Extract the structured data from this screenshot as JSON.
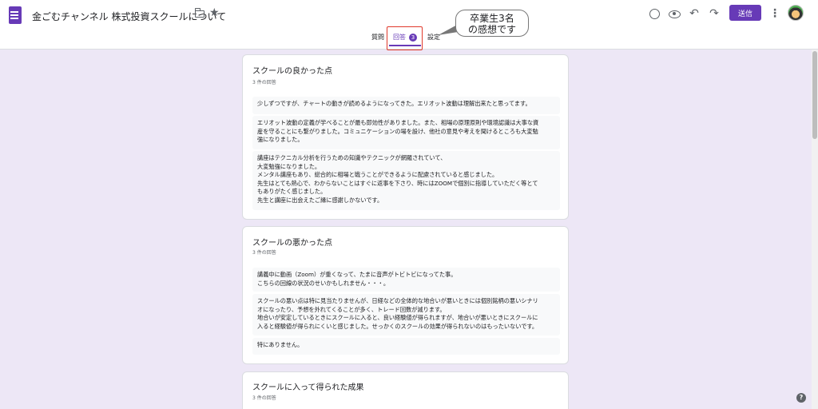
{
  "header": {
    "title": "金ごむチャンネル 株式投資スクールについて",
    "send_label": "送信",
    "icons": [
      "forms-app-icon",
      "folder-icon",
      "star-icon",
      "palette-icon",
      "preview-eye-icon",
      "undo-icon",
      "redo-icon",
      "more-vert-icon",
      "avatar"
    ]
  },
  "tabs": {
    "questions": "質問",
    "responses": "回答",
    "responses_count": "3",
    "settings": "設定"
  },
  "callout": {
    "line1": "卒業生3名",
    "line2": "の感想です"
  },
  "cards": [
    {
      "title": "スクールの良かった点",
      "sub": "3 件の回答",
      "responses": [
        [
          "少しずつですが、チャートの動きが読めるようになってきた。エリオット波動は理解出来たと思ってます。"
        ],
        [
          "エリオット波動の定義が学べることが最も即効性がありました。また、相場の原理原則や環境認識は大事な資",
          "産を守ることにも繋がりました。コミュニケーションの場を設け、他社の意見や考えを聞けるところも大変勉",
          "強になりました。"
        ],
        [
          "講座はテクニカル分析を行うための知識やテクニックが網羅されていて、",
          "大変勉強になりました。",
          "メンタル講座もあり、総合的に相場と戦うことができるように配慮されていると感じました。",
          "先生はとても熱心で、わからないことはすぐに返事を下さり、時にはZOOMで個別に指導していただく等とて",
          "もありがたく感じました。",
          "先生と講座に出会えたご縁に感謝しかないです。"
        ]
      ]
    },
    {
      "title": "スクールの悪かった点",
      "sub": "3 件の回答",
      "responses": [
        [
          "講義中に動画（Zoom）が重くなって、たまに音声がトビトビになってた事。",
          "こちらの回線の状況のせいかもしれません・・・。"
        ],
        [
          "スクールの悪い点は特に見当たりませんが、日経などの全体的な地合いが悪いときには個別銘柄の悪いシナリ",
          "オになったり、予想を外れてくることが多く、トレード回数が減ります。",
          "地合いが安定しているときにスクールに入ると、良い経験値が得られますが、地合いが悪いときにスクールに",
          "入ると経験値が得られにくいと感じました。せっかくのスクールの効果が得られないのはもったいないです。"
        ],
        [
          "特にありません。"
        ]
      ]
    },
    {
      "title": "スクールに入って得られた成果",
      "sub": "3 件の回答",
      "responses": []
    }
  ],
  "help_label": "?"
}
